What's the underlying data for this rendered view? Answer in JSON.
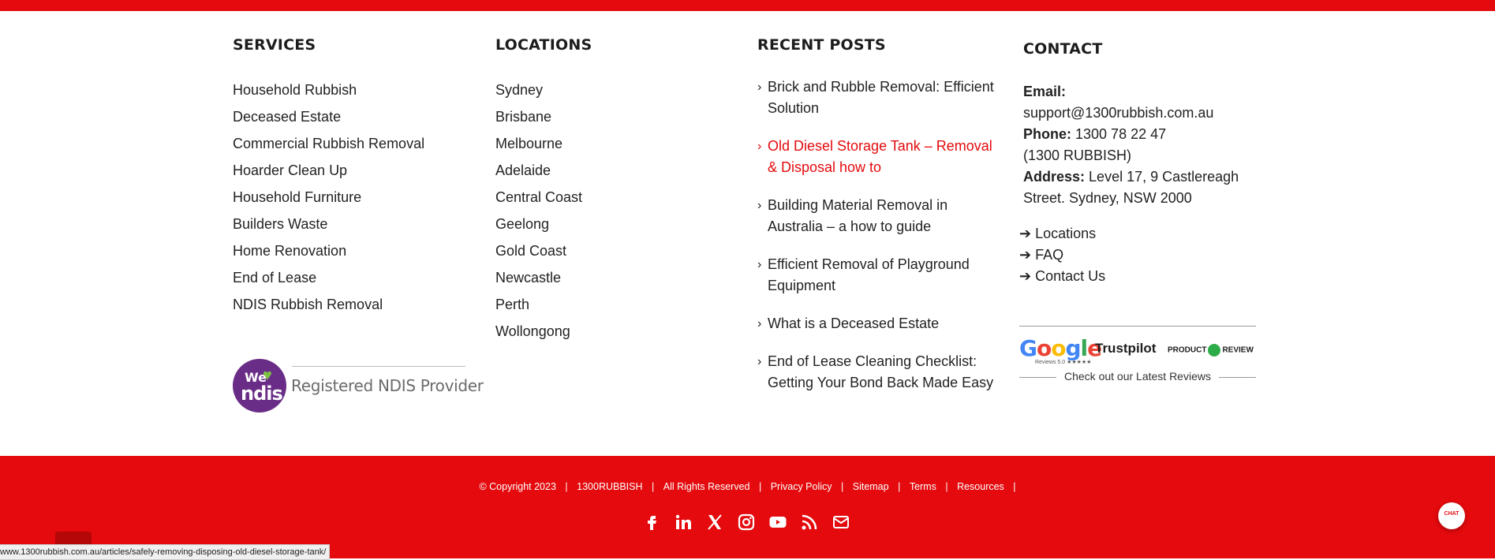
{
  "services": {
    "title": "SERVICES",
    "items": [
      "Household Rubbish",
      "Deceased Estate",
      "Commercial Rubbish Removal",
      "Hoarder Clean Up",
      "Household Furniture",
      "Builders Waste",
      "Home Renovation",
      "End of Lease",
      "NDIS Rubbish Removal"
    ],
    "ndis": {
      "we": "We",
      "ndis": "ndis",
      "label": "Registered NDIS Provider"
    }
  },
  "locations": {
    "title": "LOCATIONS",
    "items": [
      "Sydney",
      "Brisbane",
      "Melbourne",
      "Adelaide",
      "Central Coast",
      "Geelong",
      "Gold Coast",
      "Newcastle",
      "Perth",
      "Wollongong"
    ]
  },
  "recent_posts": {
    "title": "RECENT POSTS",
    "chevron": "›",
    "items": [
      "Brick and Rubble Removal: Efficient Solution",
      "Old Diesel Storage Tank – Removal & Disposal how to",
      "Building Material Removal in Australia – a how to guide",
      "Efficient Removal of Playground Equipment",
      "What is a Deceased Estate",
      "End of Lease Cleaning Checklist: Getting Your Bond Back Made Easy"
    ]
  },
  "contact": {
    "title": "CONTACT",
    "email_label": "Email:",
    "email": "support@1300rubbish.com.au",
    "phone_label": "Phone:",
    "phone": "1300 78 22 47",
    "phone_alt": "(1300 RUBBISH)",
    "address_label": "Address:",
    "address": "Level 17, 9 Castlereagh Street. Sydney, NSW 2000",
    "arrow": "➔",
    "links": [
      "Locations",
      "FAQ",
      "Contact Us"
    ],
    "reviews": {
      "google": "Google",
      "google_sub": "Reviews 5.0 ★★★★★",
      "trustpilot": "Trustpilot",
      "productreview": "PRODUCT",
      "productreview2": "REVIEW",
      "caption": "Check out our Latest Reviews"
    }
  },
  "footer": {
    "copyright": "© Copyright 2023",
    "brand": "1300RUBBISH",
    "rights": "All Rights Reserved",
    "links": [
      "Privacy Policy",
      "Sitemap",
      "Terms",
      "Resources"
    ],
    "separator": "|"
  },
  "chat": {
    "label": "CHAT"
  },
  "status_url": "www.1300rubbish.com.au/articles/safely-removing-disposing-old-diesel-storage-tank/",
  "colors": {
    "brand_red": "#e40a0d",
    "ndis_purple": "#6a2d87",
    "ndis_green": "#7cc242"
  }
}
